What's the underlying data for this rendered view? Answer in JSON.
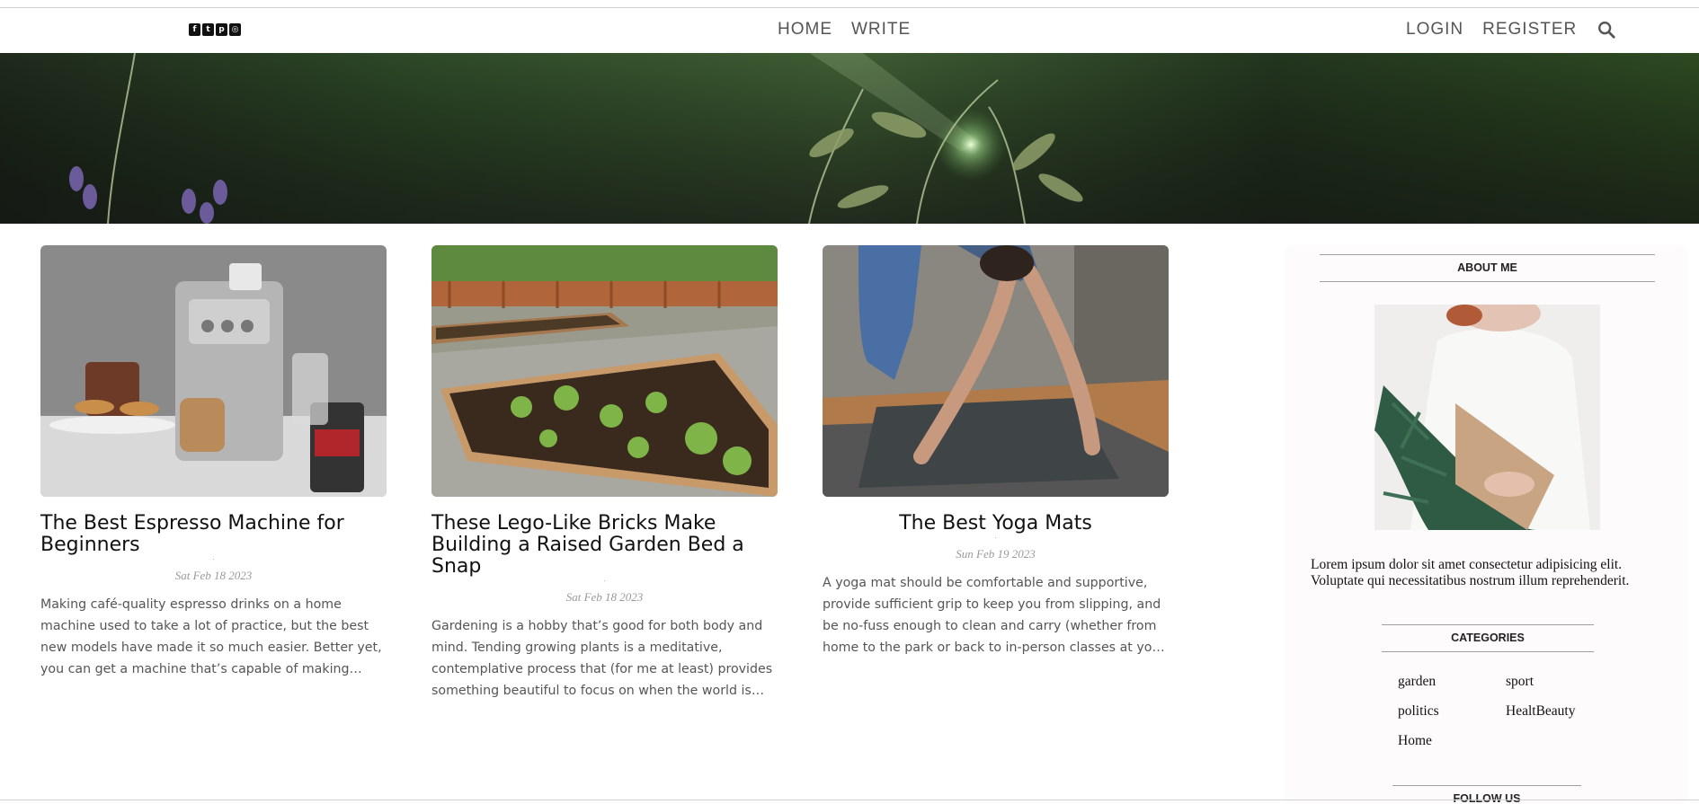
{
  "nav": {
    "socials": [
      "facebook-icon",
      "twitter-icon",
      "pinterest-icon",
      "instagram-icon"
    ],
    "center_links": [
      "HOME",
      "WRITE"
    ],
    "right_links": [
      "LOGIN",
      "REGISTER"
    ]
  },
  "posts": [
    {
      "title": "The Best Espresso Machine for Beginners",
      "date": "Sat Feb 18 2023",
      "desc": "Making café-quality espresso drinks on a home machine used to take a lot of practice, but the best new models have made it so much easier. Better yet, you can get a machine that’s capable of making excellent drinks for w…"
    },
    {
      "title": "These Lego-Like Bricks Make Building a Raised Garden Bed a Snap",
      "date": "Sat Feb 18 2023",
      "desc": "Gardening is a hobby that’s good for both body and mind. Tending growing plants is a meditative, contemplative process that (for me at least) provides something beautiful to focus on when the world is hard to process.…"
    },
    {
      "title": "The Best Yoga Mats",
      "date": "Sun Feb 19 2023",
      "desc": "A yoga mat should be comfortable and supportive, provide sufficient grip to keep you from slipping, and be no-fuss enough to clean and carry (whether from home to the park or back to in-person classes at your beloved gy…"
    }
  ],
  "sidebar": {
    "about_title": "ABOUT ME",
    "about_text": "Lorem ipsum dolor sit amet consectetur adipisicing elit. Voluptate qui necessitatibus nostrum illum reprehenderit.",
    "categories_title": "CATEGORIES",
    "categories": [
      "garden",
      "sport",
      "politics",
      "HealtBeauty",
      "Home"
    ],
    "follow_title": "FOLLOW US"
  },
  "colors": {
    "accent": "#222222",
    "muted": "#555555",
    "date": "#999999",
    "sidebar_bg": "#fdfbfb"
  }
}
